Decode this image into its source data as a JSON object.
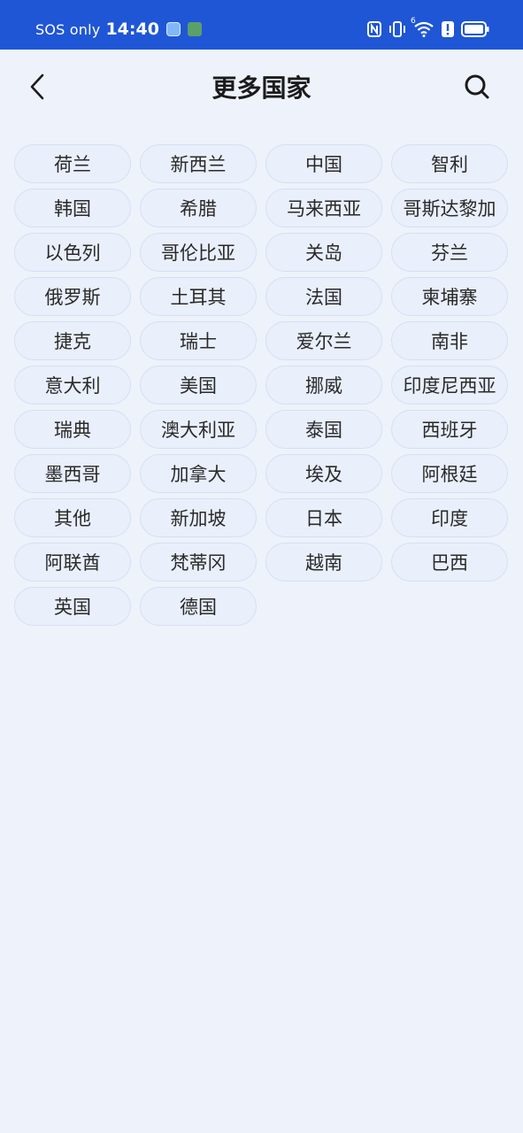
{
  "status_bar": {
    "carrier": "SOS only",
    "time": "14:40",
    "icons": [
      "gallery-app-icon",
      "game-app-icon",
      "nfc-icon",
      "vibrate-icon",
      "wifi-icon",
      "alert-icon",
      "battery-icon"
    ],
    "wifi_badge": "6"
  },
  "header": {
    "title": "更多国家",
    "back_icon": "chevron-left-icon",
    "search_icon": "search-icon"
  },
  "countries": [
    "荷兰",
    "新西兰",
    "中国",
    "智利",
    "韩国",
    "希腊",
    "马来西亚",
    "哥斯达黎加",
    "以色列",
    "哥伦比亚",
    "关岛",
    "芬兰",
    "俄罗斯",
    "土耳其",
    "法国",
    "柬埔寨",
    "捷克",
    "瑞士",
    "爱尔兰",
    "南非",
    "意大利",
    "美国",
    "挪威",
    "印度尼西亚",
    "瑞典",
    "澳大利亚",
    "泰国",
    "西班牙",
    "墨西哥",
    "加拿大",
    "埃及",
    "阿根廷",
    "其他",
    "新加坡",
    "日本",
    "印度",
    "阿联酋",
    "梵蒂冈",
    "越南",
    "巴西",
    "英国",
    "德国"
  ],
  "colors": {
    "status_bar_bg": "#1f56d6",
    "page_bg": "#eef2fa",
    "chip_bg": "#e9effb",
    "chip_border": "#d6e0f3"
  }
}
